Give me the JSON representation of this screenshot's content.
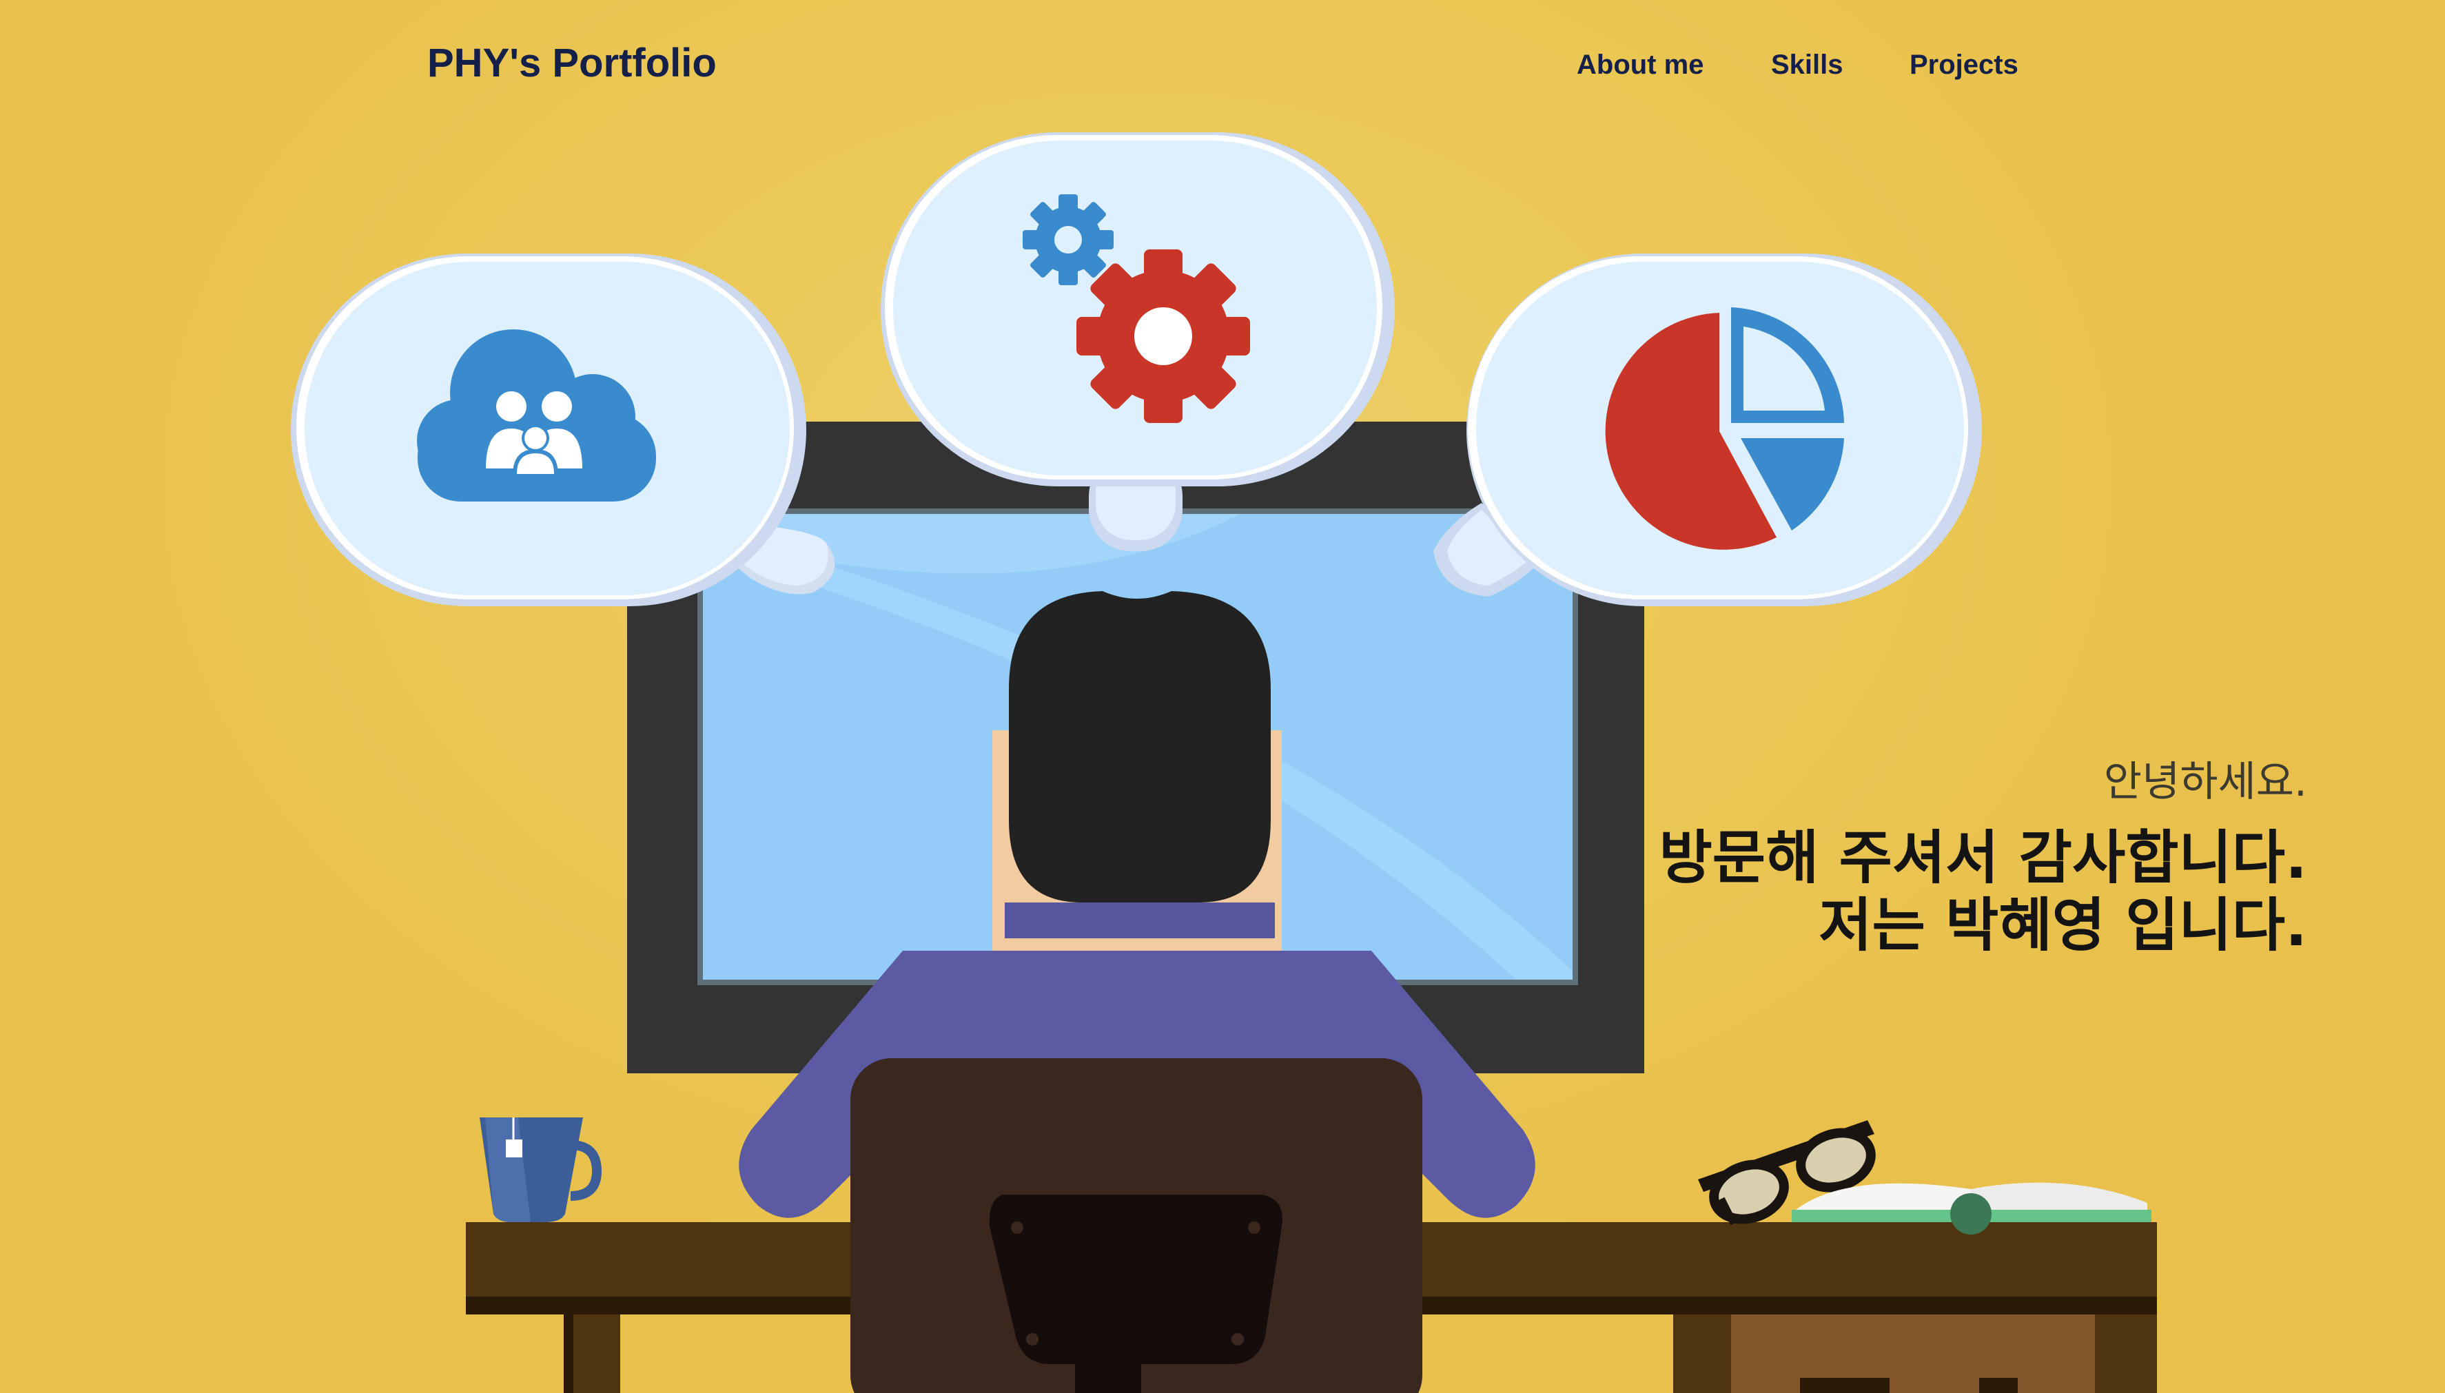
{
  "header": {
    "brand": "PHY's Portfolio",
    "nav": [
      {
        "label": "About me"
      },
      {
        "label": "Skills"
      },
      {
        "label": "Projects"
      }
    ]
  },
  "hero": {
    "greeting": "안녕하세요.",
    "line1": "방문해 주셔서 감사합니다.",
    "line2": "저는 박혜영 입니다."
  },
  "illustration": {
    "bubbles": [
      "family-cloud-icon",
      "gears-icon",
      "pie-chart-icon"
    ],
    "colors": {
      "background": "#e9c04c",
      "bubble": "#def0fe",
      "blue": "#3a8bcd",
      "red": "#c93526",
      "shirt": "#5b5aa3",
      "desk": "#4f3410",
      "chair": "#3a271d"
    }
  }
}
